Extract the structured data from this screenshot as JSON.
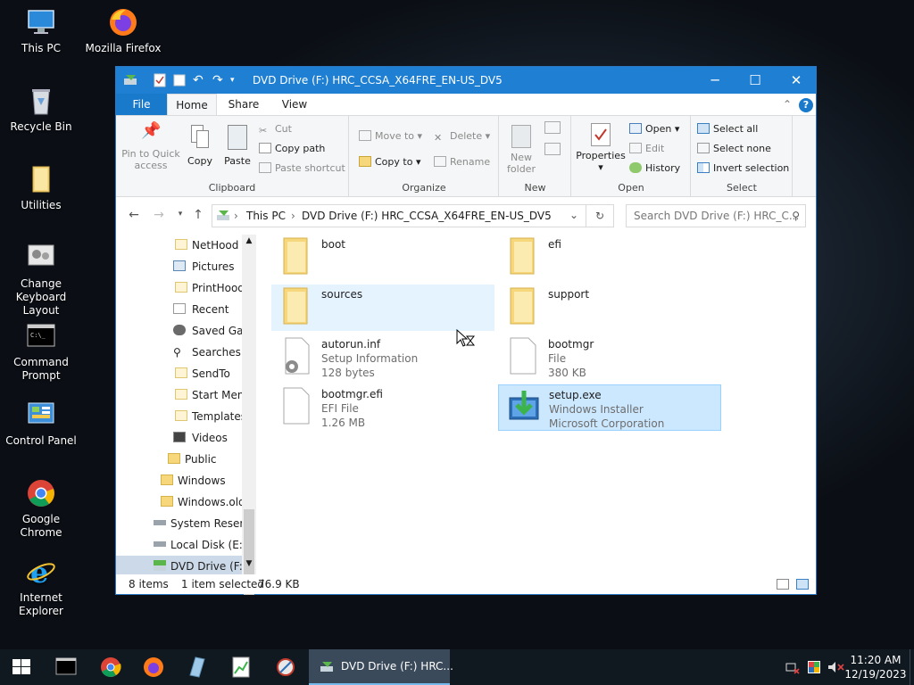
{
  "desktop": {
    "icons": [
      {
        "label": "This PC"
      },
      {
        "label": "Mozilla Firefox"
      },
      {
        "label": "Recycle Bin"
      },
      {
        "label": "Utilities"
      },
      {
        "label": "Change Keyboard Layout"
      },
      {
        "label": "Command Prompt"
      },
      {
        "label": "Control Panel"
      },
      {
        "label": "Google Chrome"
      },
      {
        "label": "Internet Explorer"
      }
    ]
  },
  "window": {
    "title": "DVD Drive (F:) HRC_CCSA_X64FRE_EN-US_DV5",
    "controls": {
      "minimize": "─",
      "maximize": "☐",
      "close": "✕"
    },
    "menu": {
      "file": "File",
      "home": "Home",
      "share": "Share",
      "view": "View",
      "help": "?"
    },
    "ribbon": {
      "clipboard": {
        "group": "Clipboard",
        "pin": "Pin to Quick access",
        "copy": "Copy",
        "paste": "Paste",
        "cut": "Cut",
        "copy_path": "Copy path",
        "paste_shortcut": "Paste shortcut"
      },
      "organize": {
        "group": "Organize",
        "move_to": "Move to",
        "copy_to": "Copy to",
        "delete": "Delete",
        "rename": "Rename"
      },
      "new": {
        "group": "New",
        "new_folder": "New folder"
      },
      "open": {
        "group": "Open",
        "properties": "Properties",
        "open": "Open",
        "edit": "Edit",
        "history": "History"
      },
      "select": {
        "group": "Select",
        "select_all": "Select all",
        "select_none": "Select none",
        "invert": "Invert selection"
      }
    },
    "address": {
      "crumb1": "This PC",
      "crumb2": "DVD Drive (F:) HRC_CCSA_X64FRE_EN-US_DV5",
      "search_placeholder": "Search DVD Drive (F:) HRC_C..."
    },
    "nav_items": [
      {
        "label": "NetHood"
      },
      {
        "label": "Pictures"
      },
      {
        "label": "PrintHood"
      },
      {
        "label": "Recent"
      },
      {
        "label": "Saved Gan"
      },
      {
        "label": "Searches"
      },
      {
        "label": "SendTo"
      },
      {
        "label": "Start Menu"
      },
      {
        "label": "Templates"
      },
      {
        "label": "Videos"
      },
      {
        "label": "Public"
      },
      {
        "label": "Windows"
      },
      {
        "label": "Windows.old"
      },
      {
        "label": "System Reserve"
      },
      {
        "label": "Local Disk (E:)"
      },
      {
        "label": "DVD Drive (F:) I"
      }
    ],
    "files": [
      {
        "name": "boot",
        "line1": "",
        "line2": ""
      },
      {
        "name": "efi",
        "line1": "",
        "line2": ""
      },
      {
        "name": "sources",
        "line1": "",
        "line2": ""
      },
      {
        "name": "support",
        "line1": "",
        "line2": ""
      },
      {
        "name": "autorun.inf",
        "line1": "Setup Information",
        "line2": "128 bytes"
      },
      {
        "name": "bootmgr",
        "line1": "File",
        "line2": "380 KB"
      },
      {
        "name": "bootmgr.efi",
        "line1": "EFI File",
        "line2": "1.26 MB"
      },
      {
        "name": "setup.exe",
        "line1": "Windows Installer",
        "line2": "Microsoft Corporation"
      }
    ],
    "status": {
      "count": "8 items",
      "selected": "1 item selected",
      "size": "76.9 KB"
    }
  },
  "taskbar": {
    "active_window": "DVD Drive (F:) HRC...",
    "time": "11:20 AM",
    "date": "12/19/2023"
  },
  "colors": {
    "titlebar": "#1e7fd3",
    "accent": "#1979ca",
    "selection": "#cce8ff",
    "taskbar": "#101820"
  }
}
